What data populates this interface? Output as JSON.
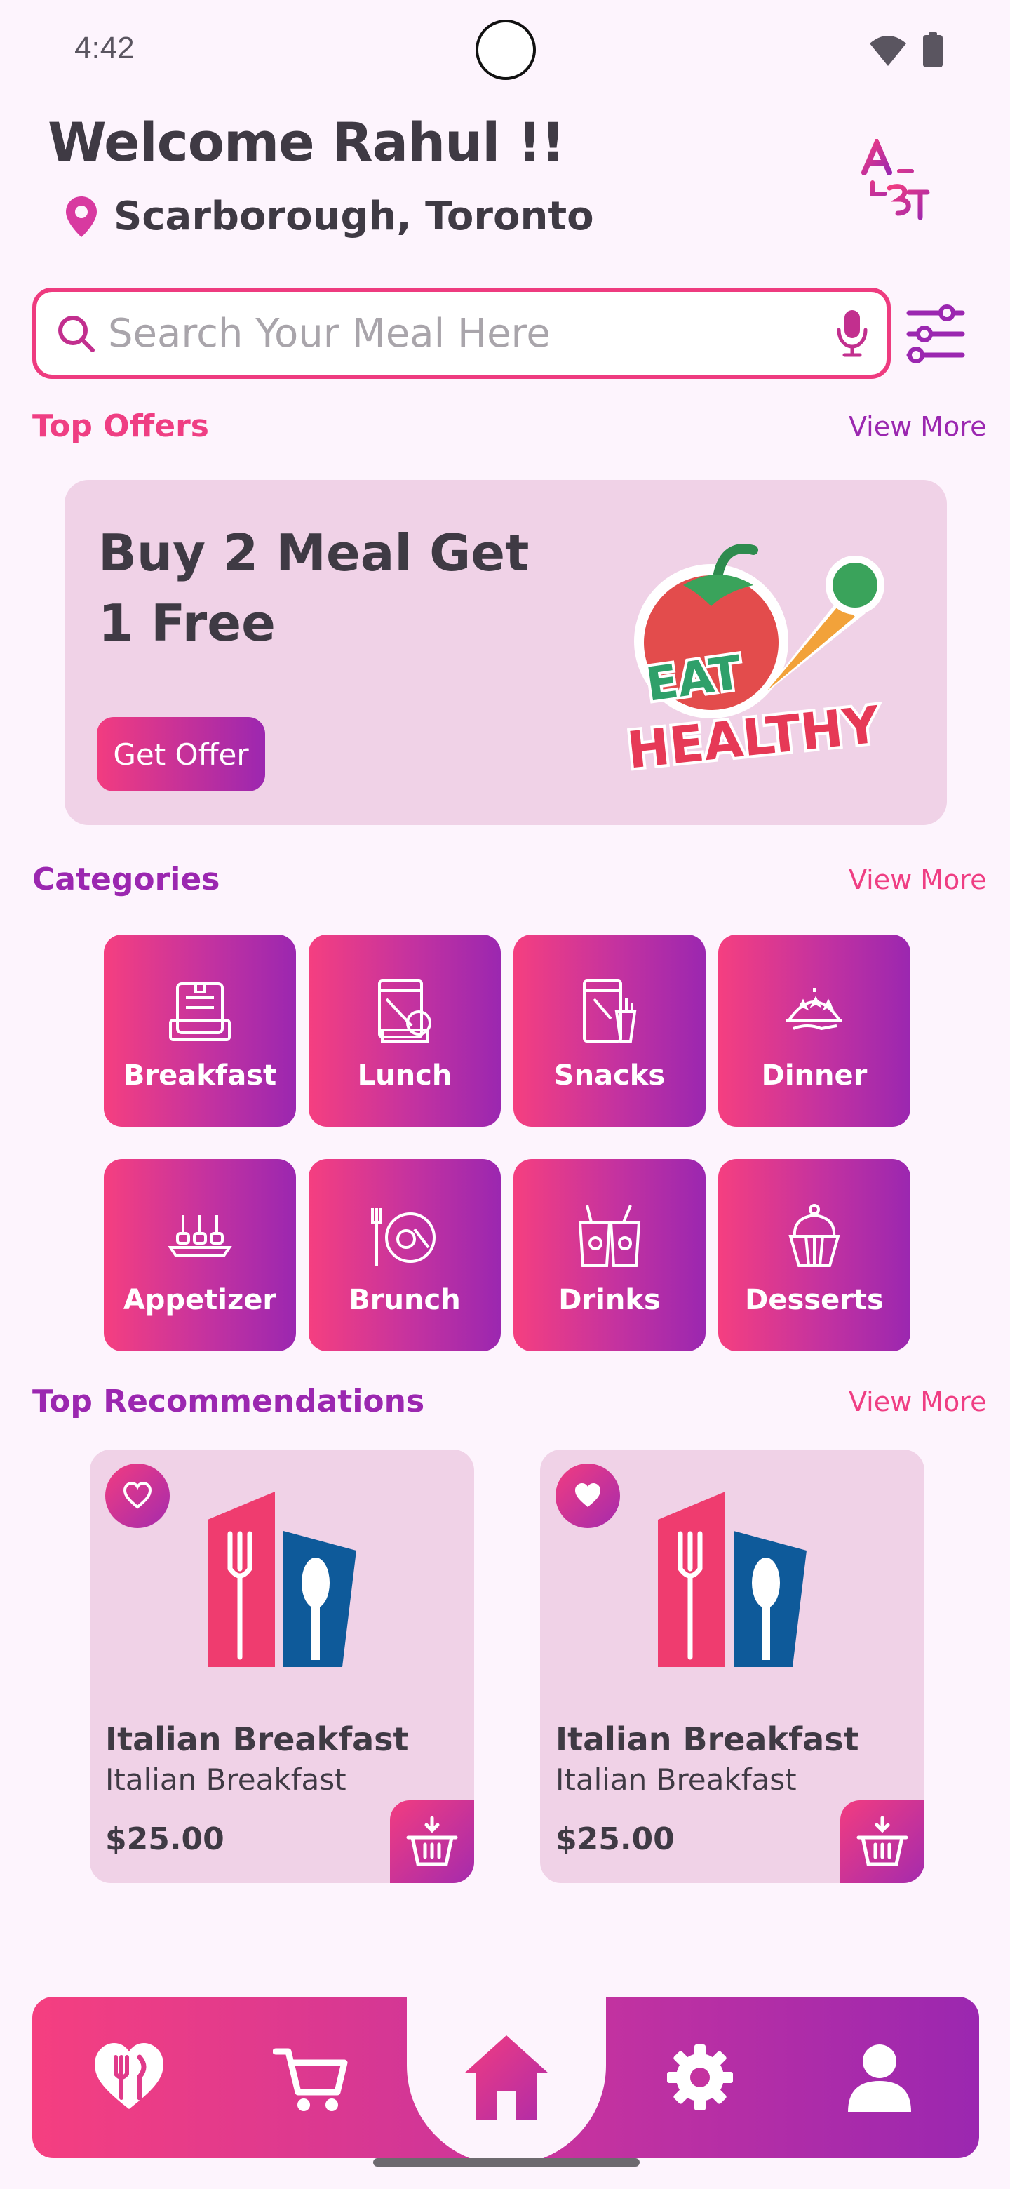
{
  "status": {
    "time": "4:42"
  },
  "header": {
    "welcome": "Welcome Rahul !!",
    "location": "Scarborough, Toronto"
  },
  "search": {
    "placeholder": "Search Your Meal Here",
    "value": ""
  },
  "top_offers": {
    "title": "Top Offers",
    "view_more": "View More",
    "offer": {
      "title": "Buy 2 Meal Get 1 Free",
      "button": "Get Offer",
      "art_text": [
        "EAT",
        "HEALTHY"
      ]
    }
  },
  "categories": {
    "title": "Categories",
    "view_more": "View More",
    "items": [
      {
        "label": "Breakfast",
        "icon": "breakfast-icon"
      },
      {
        "label": "Lunch",
        "icon": "lunch-icon"
      },
      {
        "label": "Snacks",
        "icon": "snacks-icon"
      },
      {
        "label": "Dinner",
        "icon": "dinner-icon"
      },
      {
        "label": "Appetizer",
        "icon": "appetizer-icon"
      },
      {
        "label": "Brunch",
        "icon": "brunch-icon"
      },
      {
        "label": "Drinks",
        "icon": "drinks-icon"
      },
      {
        "label": "Desserts",
        "icon": "desserts-icon"
      }
    ]
  },
  "recommendations": {
    "title": "Top Recommendations",
    "view_more": "View More",
    "items": [
      {
        "name": "Italian Breakfast",
        "subtitle": "Italian Breakfast",
        "price": "$25.00",
        "favorited": false
      },
      {
        "name": "Italian Breakfast",
        "subtitle": "Italian Breakfast",
        "price": "$25.00",
        "favorited": true
      }
    ]
  },
  "bottom_nav": {
    "items": [
      "favorites-icon",
      "cart-icon",
      "home-icon",
      "settings-icon",
      "profile-icon"
    ],
    "active": "home-icon"
  },
  "colors": {
    "pink": "#ef3e83",
    "purple": "#9b27b0",
    "card_bg": "#f0d2e7",
    "page_bg": "#fdf4fd"
  }
}
